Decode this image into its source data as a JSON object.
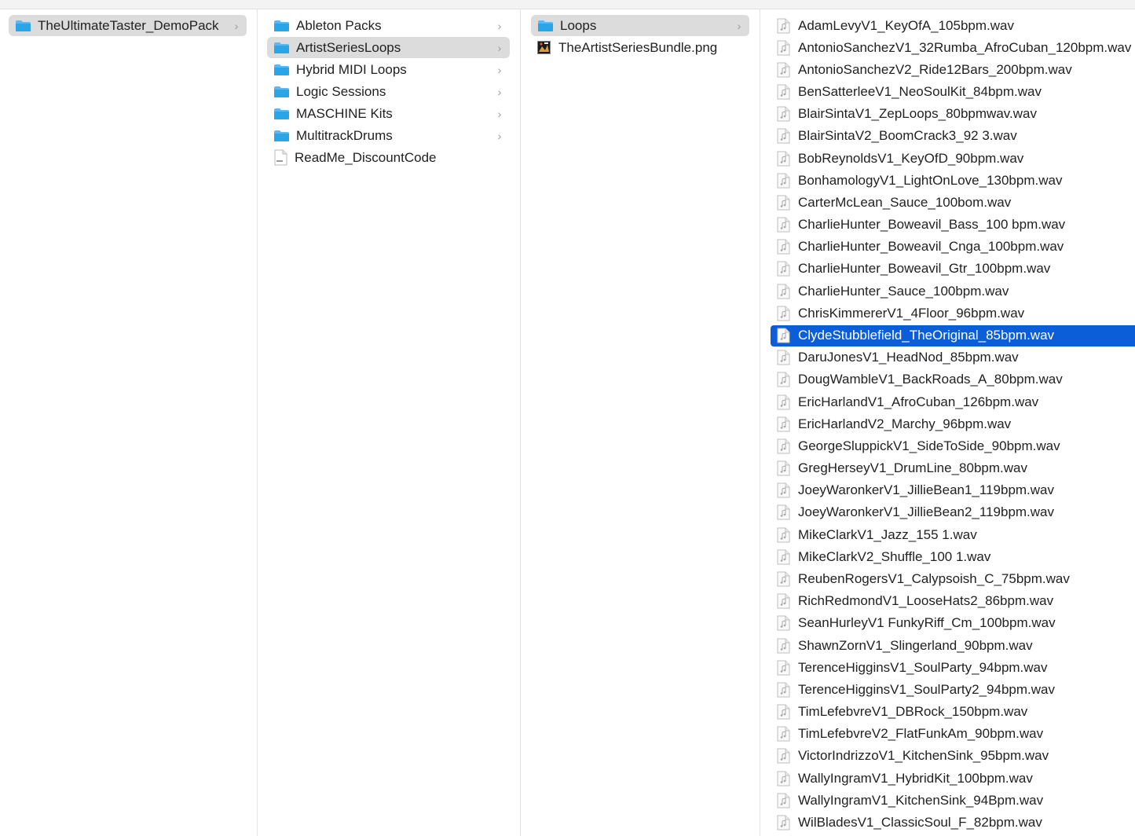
{
  "column1": {
    "items": [
      {
        "label": "TheUltimateTaster_DemoPack",
        "type": "folder",
        "chevron": "›"
      }
    ]
  },
  "column2": {
    "items": [
      {
        "label": "Ableton Packs",
        "type": "folder",
        "chevron": "›"
      },
      {
        "label": "ArtistSeriesLoops",
        "type": "folder",
        "chevron": "›"
      },
      {
        "label": "Hybrid MIDI Loops",
        "type": "folder",
        "chevron": "›"
      },
      {
        "label": "Logic Sessions",
        "type": "folder",
        "chevron": "›"
      },
      {
        "label": "MASCHINE Kits",
        "type": "folder",
        "chevron": "›"
      },
      {
        "label": "MultitrackDrums",
        "type": "folder",
        "chevron": "›"
      },
      {
        "label": "ReadMe_DiscountCode",
        "type": "document"
      }
    ]
  },
  "column3": {
    "items": [
      {
        "label": "Loops",
        "type": "folder",
        "chevron": "›"
      },
      {
        "label": "TheArtistSeriesBundle.png",
        "type": "image"
      }
    ]
  },
  "column4": {
    "items": [
      "AdamLevyV1_KeyOfA_105bpm.wav",
      "AntonioSanchezV1_32Rumba_AfroCuban_120bpm.wav",
      "AntonioSanchezV2_Ride12Bars_200bpm.wav",
      "BenSatterleeV1_NeoSoulKit_84bpm.wav",
      "BlairSintaV1_ZepLoops_80bpmwav.wav",
      "BlairSintaV2_BoomCrack3_92 3.wav",
      "BobReynoldsV1_KeyOfD_90bpm.wav",
      "BonhamologyV1_LightOnLove_130bpm.wav",
      "CarterMcLean_Sauce_100bom.wav",
      "CharlieHunter_Boweavil_Bass_100 bpm.wav",
      "CharlieHunter_Boweavil_Cnga_100bpm.wav",
      "CharlieHunter_Boweavil_Gtr_100bpm.wav",
      "CharlieHunter_Sauce_100bpm.wav",
      "ChrisKimmererV1_4Floor_96bpm.wav",
      "ClydeStubblefield_TheOriginal_85bpm.wav",
      "DaruJonesV1_HeadNod_85bpm.wav",
      "DougWambleV1_BackRoads_A_80bpm.wav",
      "EricHarlandV1_AfroCuban_126bpm.wav",
      "EricHarlandV2_Marchy_96bpm.wav",
      "GeorgeSluppickV1_SideToSide_90bpm.wav",
      "GregHerseyV1_DrumLine_80bpm.wav",
      "JoeyWaronkerV1_JillieBean1_119bpm.wav",
      "JoeyWaronkerV1_JillieBean2_119bpm.wav",
      "MikeClarkV1_Jazz_155 1.wav",
      "MikeClarkV2_Shuffle_100 1.wav",
      "ReubenRogersV1_Calypsoish_C_75bpm.wav",
      "RichRedmondV1_LooseHats2_86bpm.wav",
      "SeanHurleyV1 FunkyRiff_Cm_100bpm.wav",
      "ShawnZornV1_Slingerland_90bpm.wav",
      "TerenceHigginsV1_SoulParty_94bpm.wav",
      "TerenceHigginsV1_SoulParty2_94bpm.wav",
      "TimLefebvreV1_DBRock_150bpm.wav",
      "TimLefebvreV2_FlatFunkAm_90bpm.wav",
      "VictorIndrizzoV1_KitchenSink_95bpm.wav",
      "WallyIngramV1_HybridKit_100bpm.wav",
      "WallyIngramV1_KitchenSink_94Bpm.wav",
      "WilBladesV1_ClassicSoul_F_82bpm.wav"
    ],
    "selected": "ClydeStubblefield_TheOriginal_85bpm.wav"
  },
  "colors": {
    "selection_blue": "#0b5ed7",
    "path_gray": "#dcdcdc",
    "folder_blue": "#2aa5e8"
  },
  "icons": {
    "folder": "folder-icon",
    "document": "document-icon",
    "image": "image-file-icon",
    "audio": "audio-file-icon",
    "chevron": "chevron-right-icon"
  }
}
